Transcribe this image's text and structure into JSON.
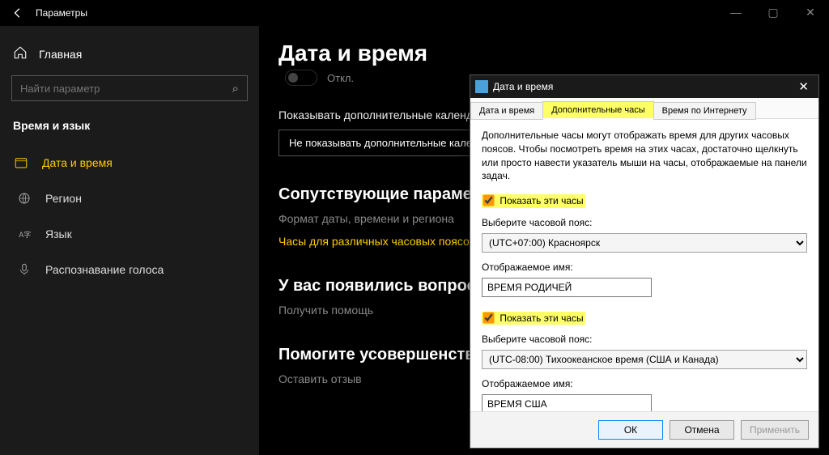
{
  "window": {
    "title": "Параметры",
    "buttons": {
      "min": "—",
      "max": "▢",
      "close": "✕"
    }
  },
  "sidebar": {
    "home": "Главная",
    "search_placeholder": "Найти параметр",
    "search_icon": "⌕",
    "category": "Время и язык",
    "items": [
      {
        "label": "Дата и время",
        "selected": true
      },
      {
        "label": "Регион",
        "selected": false
      },
      {
        "label": "Язык",
        "selected": false
      },
      {
        "label": "Распознавание голоса",
        "selected": false
      }
    ]
  },
  "main": {
    "heading": "Дата и время",
    "toggle_label": "Откл.",
    "cal_label": "Показывать дополнительные календари на панели задач",
    "cal_dropdown": "Не показывать дополнительные календари",
    "related_heading": "Сопутствующие параметры",
    "related_link1": "Формат даты, времени и региона",
    "related_link2": "Часы для различных часовых поясов",
    "help_heading": "У вас появились вопросы?",
    "help_link": "Получить помощь",
    "improve_heading": "Помогите усовершенствовать",
    "improve_link": "Оставить отзыв"
  },
  "dialog": {
    "title": "Дата и время",
    "tabs": [
      "Дата и время",
      "Дополнительные часы",
      "Время по Интернету"
    ],
    "intro": "Дополнительные часы могут отображать время для других часовых поясов. Чтобы посмотреть время на этих часах, достаточно щелкнуть или просто навести указатель мыши на часы, отображаемые на панели задач.",
    "clocks": [
      {
        "show_label": "Показать эти часы",
        "checked": true,
        "tz_label": "Выберите часовой пояс:",
        "tz_value": "(UTC+07:00) Красноярск",
        "name_label": "Отображаемое имя:",
        "name_value": "ВРЕМЯ РОДИЧЕЙ"
      },
      {
        "show_label": "Показать эти часы",
        "checked": true,
        "tz_label": "Выберите часовой пояс:",
        "tz_value": "(UTC-08:00) Тихоокеанское время (США и Канада)",
        "name_label": "Отображаемое имя:",
        "name_value": "ВРЕМЯ США"
      }
    ],
    "buttons": {
      "ok": "ОК",
      "cancel": "Отмена",
      "apply": "Применить"
    }
  }
}
